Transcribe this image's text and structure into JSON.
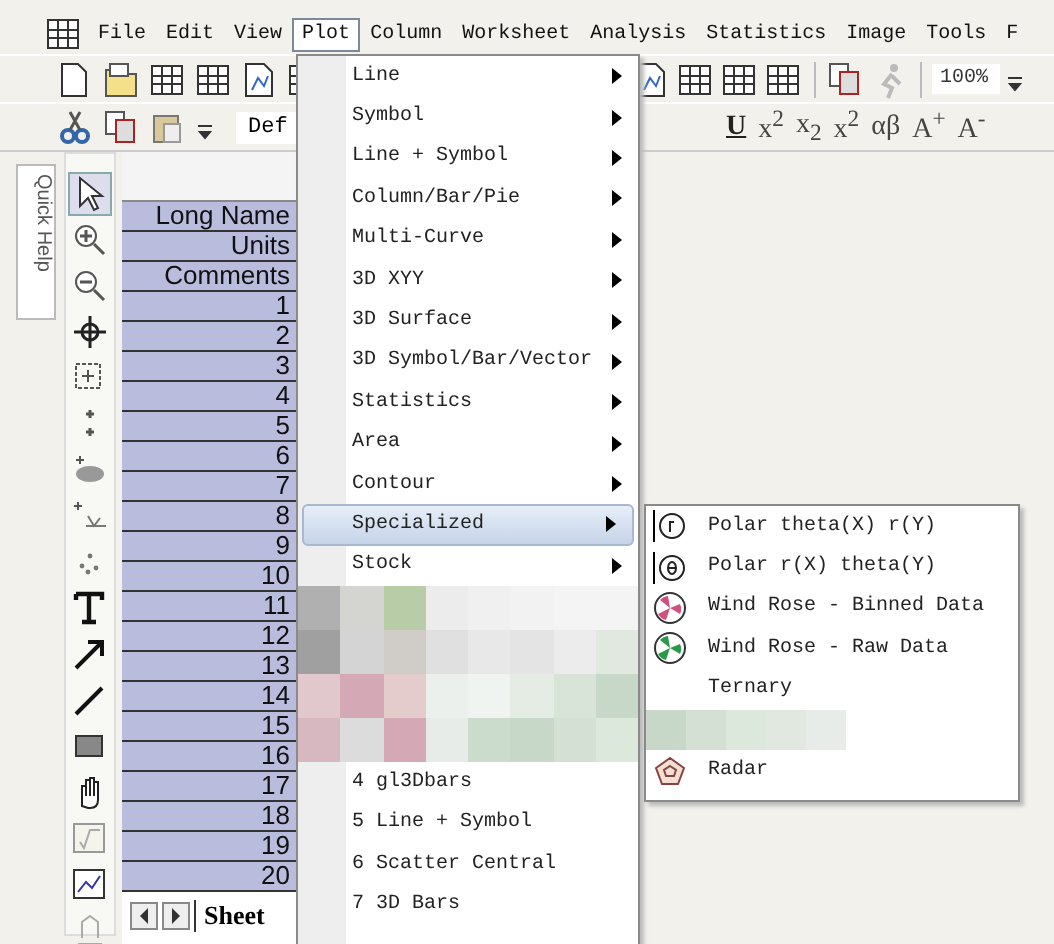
{
  "menubar": [
    {
      "label": "File",
      "selected": false
    },
    {
      "label": "Edit",
      "selected": false
    },
    {
      "label": "View",
      "selected": false
    },
    {
      "label": "Plot",
      "selected": true
    },
    {
      "label": "Column",
      "selected": false
    },
    {
      "label": "Worksheet",
      "selected": false
    },
    {
      "label": "Analysis",
      "selected": false
    },
    {
      "label": "Statistics",
      "selected": false
    },
    {
      "label": "Image",
      "selected": false
    },
    {
      "label": "Tools",
      "selected": false
    },
    {
      "label": "F",
      "selected": false
    }
  ],
  "zoom_box": {
    "value": "100%"
  },
  "font_box": {
    "value": "Def"
  },
  "format_buttons": [
    "U",
    "x$^{2}$",
    "x$_{2}$",
    "x$^{2}$",
    "αβ",
    "A$^{+}$",
    "A$^{-}$"
  ],
  "quick_help": {
    "label": "Quick Help"
  },
  "worksheet": {
    "header_labels": [
      "Long Name",
      "Units",
      "Comments"
    ],
    "row_numbers": [
      "1",
      "2",
      "3",
      "4",
      "5",
      "6",
      "7",
      "8",
      "9",
      "10",
      "11",
      "12",
      "13",
      "14",
      "15",
      "16",
      "17",
      "18",
      "19",
      "20"
    ],
    "sheet_tab": "Sheet"
  },
  "plot_menu": {
    "items": [
      {
        "label": "Line",
        "kind": "submenu",
        "selected": false
      },
      {
        "label": "Symbol",
        "kind": "submenu",
        "selected": false
      },
      {
        "label": "Line + Symbol",
        "kind": "submenu",
        "selected": false
      },
      {
        "label": "Column/Bar/Pie",
        "kind": "submenu",
        "selected": false
      },
      {
        "label": "Multi-Curve",
        "kind": "submenu",
        "selected": false
      },
      {
        "label": "3D XYY",
        "kind": "submenu",
        "selected": false
      },
      {
        "label": "3D Surface",
        "kind": "submenu",
        "selected": false
      },
      {
        "label": "3D Symbol/Bar/Vector",
        "kind": "submenu",
        "selected": false
      },
      {
        "label": "Statistics",
        "kind": "submenu",
        "selected": false
      },
      {
        "label": "Area",
        "kind": "submenu",
        "selected": false
      },
      {
        "label": "Contour",
        "kind": "submenu",
        "selected": false
      },
      {
        "label": "Specialized",
        "kind": "submenu",
        "selected": true
      },
      {
        "label": "Stock",
        "kind": "submenu",
        "selected": false
      },
      {
        "kind": "obscured"
      },
      {
        "label": "4 gl3Dbars",
        "kind": "command",
        "selected": false
      },
      {
        "label": "5 Line + Symbol",
        "kind": "command",
        "selected": false
      },
      {
        "label": "6 Scatter Central",
        "kind": "command",
        "selected": false
      },
      {
        "label": "7 3D Bars",
        "kind": "command",
        "selected": false
      }
    ]
  },
  "specialized_menu": {
    "items": [
      {
        "label": "Polar theta(X) r(Y)",
        "kind": "item"
      },
      {
        "label": "Polar r(X) theta(Y)",
        "kind": "item"
      },
      {
        "label": "Wind Rose - Binned Data",
        "kind": "item"
      },
      {
        "label": "Wind Rose - Raw Data",
        "kind": "item"
      },
      {
        "label": "Ternary",
        "kind": "item"
      },
      {
        "kind": "obscured"
      },
      {
        "label": "Radar",
        "kind": "item"
      }
    ]
  }
}
